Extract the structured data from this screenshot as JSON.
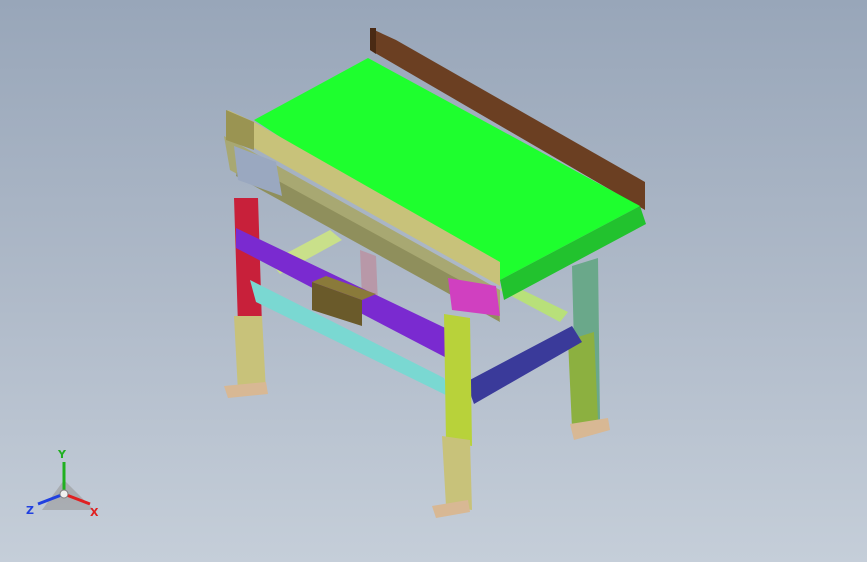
{
  "viewport": {
    "background_top": "#98a6b9",
    "background_bottom": "#c5ced9"
  },
  "model": {
    "belt_color": "#1eff2e",
    "side_guard_color": "#6b3f22",
    "end_guard_color": "#c8c27a",
    "frame_color": "#a8a872",
    "leg_front_left_color": "#c8203a",
    "leg_front_right_color": "#b8d23a",
    "leg_back_right_color": "#6aa88a",
    "brace_purple_color": "#7a2ad0",
    "brace_cyan_color": "#7ad8d2",
    "brace_blue_color": "#3a3a9a",
    "motor_color": "#6a5a2a",
    "drive_color": "#d040c0",
    "foot_color": "#d8b894"
  },
  "triad": {
    "x_label": "X",
    "y_label": "Y",
    "z_label": "Z",
    "x_color": "#e02020",
    "y_color": "#20b020",
    "z_color": "#2040e0"
  }
}
